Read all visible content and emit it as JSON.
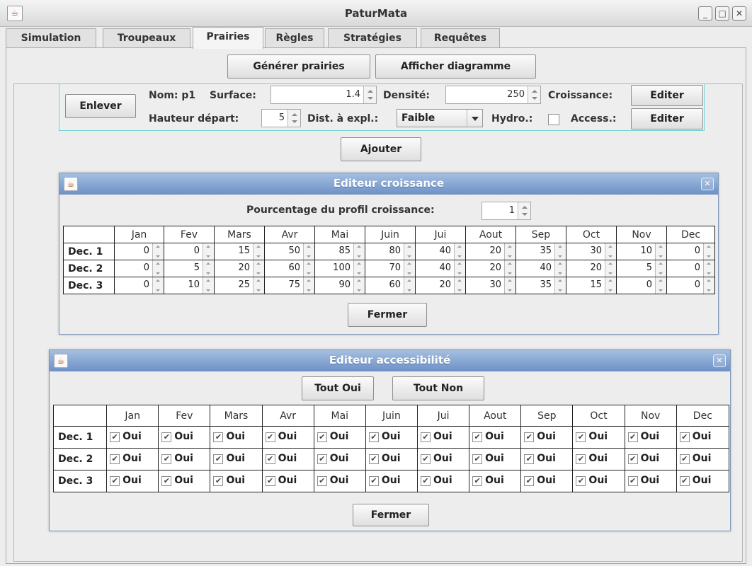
{
  "window": {
    "title": "PaturMata",
    "icon": "java-icon"
  },
  "tabs": [
    {
      "label": "Simulation",
      "active": false
    },
    {
      "label": "Troupeaux",
      "active": false
    },
    {
      "label": "Prairies",
      "active": true
    },
    {
      "label": "Règles",
      "active": false
    },
    {
      "label": "Stratégies",
      "active": false
    },
    {
      "label": "Requêtes",
      "active": false
    }
  ],
  "toolbar": {
    "generate_label": "Générer prairies",
    "diagram_label": "Afficher diagramme"
  },
  "prairie": {
    "remove_label": "Enlever",
    "name_label": "Nom: p1",
    "surface_label": "Surface:",
    "surface_value": "1.4",
    "density_label": "Densité:",
    "density_value": "250",
    "growth_label": "Croissance:",
    "growth_edit_label": "Editer",
    "start_height_label": "Hauteur départ:",
    "start_height_value": "5",
    "dist_label": "Dist. à expl.:",
    "dist_value": "Faible",
    "hydro_label": "Hydro.:",
    "access_label": "Access.:",
    "access_edit_label": "Editer",
    "add_label": "Ajouter"
  },
  "growth_editor": {
    "title": "Editeur croissance",
    "percent_label": "Pourcentage du profil croissance:",
    "percent_value": "1",
    "months": [
      "Jan",
      "Fev",
      "Mars",
      "Avr",
      "Mai",
      "Juin",
      "Jui",
      "Aout",
      "Sep",
      "Oct",
      "Nov",
      "Dec"
    ],
    "rows": [
      {
        "label": "Dec. 1",
        "values": [
          "0",
          "0",
          "15",
          "50",
          "85",
          "80",
          "40",
          "20",
          "35",
          "30",
          "10",
          "0"
        ]
      },
      {
        "label": "Dec. 2",
        "values": [
          "0",
          "5",
          "20",
          "60",
          "100",
          "70",
          "40",
          "20",
          "40",
          "20",
          "5",
          "0"
        ]
      },
      {
        "label": "Dec. 3",
        "values": [
          "0",
          "10",
          "25",
          "75",
          "90",
          "60",
          "20",
          "30",
          "35",
          "15",
          "0",
          "0"
        ]
      }
    ],
    "close_label": "Fermer"
  },
  "access_editor": {
    "title": "Editeur accessibilité",
    "all_yes_label": "Tout Oui",
    "all_no_label": "Tout Non",
    "months": [
      "Jan",
      "Fev",
      "Mars",
      "Avr",
      "Mai",
      "Juin",
      "Jui",
      "Aout",
      "Sep",
      "Oct",
      "Nov",
      "Dec"
    ],
    "yes_text": "Oui",
    "rows": [
      {
        "label": "Dec. 1"
      },
      {
        "label": "Dec. 2"
      },
      {
        "label": "Dec. 3"
      }
    ],
    "close_label": "Fermer"
  }
}
